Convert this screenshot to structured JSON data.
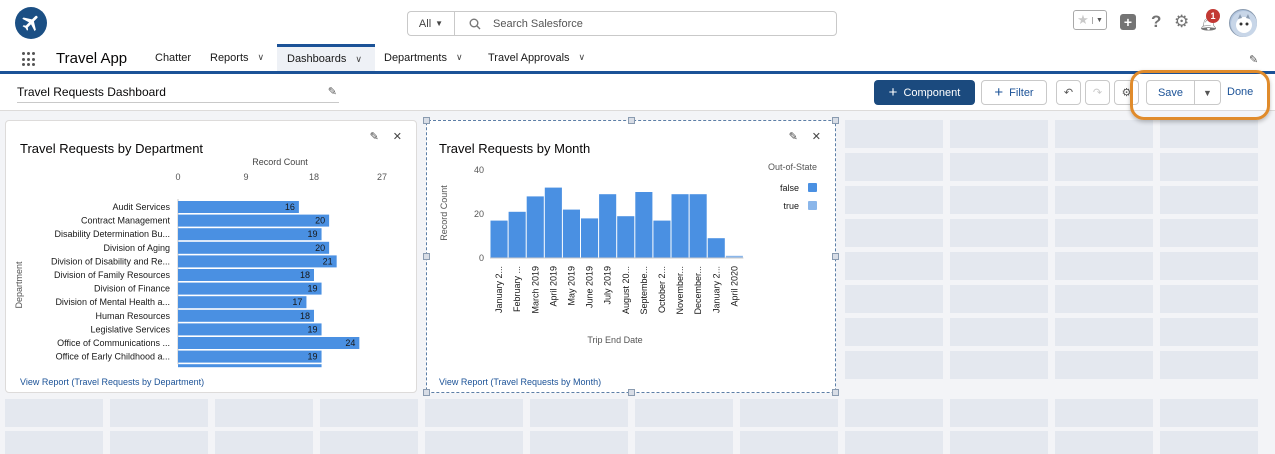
{
  "header": {
    "search_scope": "All",
    "search_placeholder": "Search Salesforce",
    "notification_count": "1"
  },
  "nav": {
    "app_name": "Travel App",
    "items": [
      {
        "label": "Chatter",
        "has_menu": false
      },
      {
        "label": "Reports",
        "has_menu": true
      },
      {
        "label": "Dashboards",
        "has_menu": true,
        "active": true
      },
      {
        "label": "Departments",
        "has_menu": true
      },
      {
        "label": "Travel Approvals",
        "has_menu": true
      }
    ]
  },
  "toolbar": {
    "dashboard_title": "Travel Requests Dashboard",
    "component_label": "Component",
    "filter_label": "Filter",
    "save_label": "Save",
    "done_label": "Done"
  },
  "widgets": {
    "department": {
      "title": "Travel Requests by Department",
      "link": "View Report (Travel Requests by Department)"
    },
    "month": {
      "title": "Travel Requests by Month",
      "link": "View Report (Travel Requests by Month)"
    }
  },
  "chart_data": [
    {
      "type": "bar",
      "orientation": "horizontal",
      "title": "",
      "xlabel": "Record Count",
      "ylabel": "Department",
      "xticks": [
        0,
        9,
        18,
        27
      ],
      "xlim": [
        0,
        27
      ],
      "categories": [
        "Audit Services",
        "Contract Management",
        "Disability Determination Bu...",
        "Division of Aging",
        "Division of Disability and Re...",
        "Division of Family Resources",
        "Division of Finance",
        "Division of Mental Health a...",
        "Human Resources",
        "Legislative Services",
        "Office of Communications ...",
        "Office of Early Childhood a..."
      ],
      "values": [
        16,
        20,
        19,
        20,
        21,
        18,
        19,
        17,
        18,
        19,
        24,
        19
      ],
      "color": "#4a90e2"
    },
    {
      "type": "bar",
      "title": "",
      "xlabel": "Trip End Date",
      "ylabel": "Record Count",
      "yticks": [
        0,
        20,
        40
      ],
      "ylim": [
        0,
        40
      ],
      "categories": [
        "January 2...",
        "February ...",
        "March 2019",
        "April 2019",
        "May 2019",
        "June 2019",
        "July 2019",
        "August 20...",
        "Septembe...",
        "October 2...",
        "November...",
        "December...",
        "January 2...",
        "April 2020"
      ],
      "series": [
        {
          "name": "false",
          "color": "#4a90e2",
          "values": [
            17,
            21,
            28,
            32,
            22,
            18,
            29,
            19,
            30,
            17,
            29,
            29,
            9,
            0
          ]
        },
        {
          "name": "true",
          "color": "#8ab6ea",
          "values": [
            0,
            0,
            0,
            0,
            0,
            0,
            0,
            0,
            0,
            0,
            0,
            0,
            0,
            1
          ]
        }
      ],
      "legend_title": "Out-of-State",
      "legend_position": "top-right"
    }
  ]
}
